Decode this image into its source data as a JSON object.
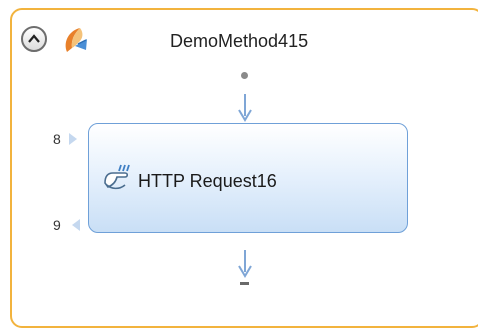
{
  "method": {
    "title": "DemoMethod415",
    "collapse_icon": "chevron-up-icon",
    "type_icon": "method-icon"
  },
  "activity": {
    "label": "HTTP Request16",
    "icon": "http-request-hand-icon",
    "input_port": "8",
    "output_port": "9"
  },
  "colors": {
    "frame_border": "#f2b33d",
    "activity_border": "#6fa0d8",
    "connector_arrow": "#7fa6d6"
  }
}
